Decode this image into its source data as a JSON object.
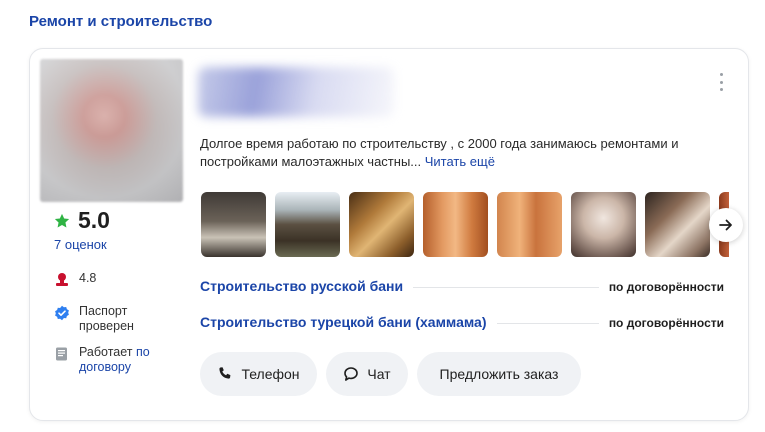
{
  "section_title": "Ремонт и строительство",
  "profile": {
    "rating": "5.0",
    "reviews": "7 оценок",
    "score": "4.8",
    "passport_line1": "Паспорт",
    "passport_line2": "проверен",
    "works_prefix": "Работает",
    "works_link_1": "по",
    "works_link_2": "договору"
  },
  "description": {
    "text": "Долгое время работаю по строительству , с 2000 года занимаюсь ремонтами и постройками малоэтажных частны...",
    "read_more": "Читать ещё"
  },
  "services": [
    {
      "name": "Строительство русской бани",
      "price": "по договорённости"
    },
    {
      "name": "Строительство турецкой бани (хаммама)",
      "price": "по договорённости"
    }
  ],
  "actions": {
    "phone": "Телефон",
    "chat": "Чат",
    "order": "Предложить заказ"
  },
  "icons": {
    "rating": "star-icon",
    "score": "medal-icon",
    "passport": "verified-check-icon",
    "contract": "document-icon",
    "next": "arrow-right-icon",
    "more": "kebab-menu-icon",
    "phone": "phone-icon",
    "chat": "chat-bubble-icon"
  },
  "colors": {
    "link": "#1b45a8",
    "star": "#2fb344",
    "verified": "#2e7ff0",
    "medal": "#c8102e",
    "button_bg": "#f0f2f5"
  }
}
